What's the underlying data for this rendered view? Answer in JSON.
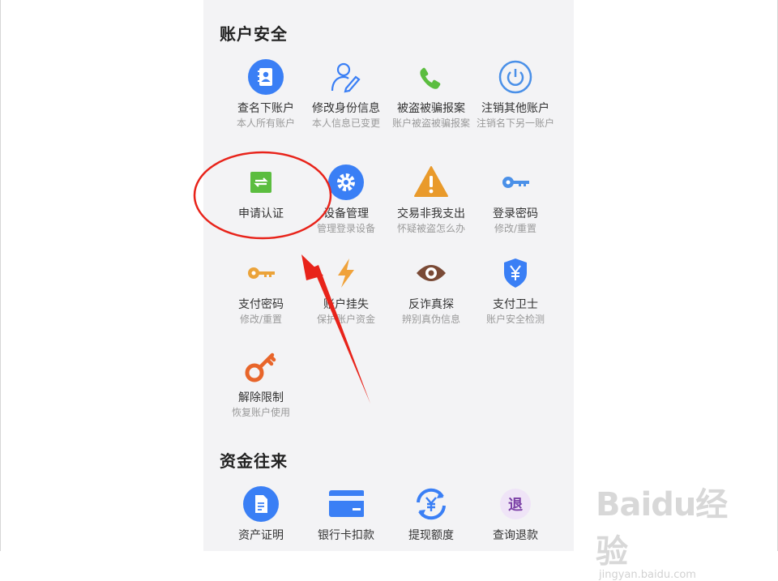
{
  "sections": [
    {
      "title": "账户安全",
      "items": [
        {
          "label": "查名下账户",
          "sub": "本人所有账户",
          "icon": "contacts-icon"
        },
        {
          "label": "修改身份信息",
          "sub": "本人信息已变更",
          "icon": "edit-user-icon"
        },
        {
          "label": "被盗被骗报案",
          "sub": "账户被盗被骗报案",
          "icon": "phone-icon"
        },
        {
          "label": "注销其他账户",
          "sub": "注销名下另一账户",
          "icon": "power-icon"
        },
        {
          "label": "申请认证",
          "sub": "",
          "icon": "swap-icon"
        },
        {
          "label": "设备管理",
          "sub": "管理登录设备",
          "icon": "gear-icon"
        },
        {
          "label": "交易非我支出",
          "sub": "怀疑被盗怎么办",
          "icon": "warning-icon"
        },
        {
          "label": "登录密码",
          "sub": "修改/重置",
          "icon": "key-blue-icon"
        },
        {
          "label": "支付密码",
          "sub": "修改/重置",
          "icon": "key-orange-icon"
        },
        {
          "label": "账户挂失",
          "sub": "保护账户资金",
          "icon": "lightning-icon"
        },
        {
          "label": "反诈真探",
          "sub": "辨别真伪信息",
          "icon": "eye-icon"
        },
        {
          "label": "支付卫士",
          "sub": "账户安全检测",
          "icon": "shield-yen-icon"
        },
        {
          "label": "解除限制",
          "sub": "恢复账户使用",
          "icon": "key-red-icon"
        }
      ]
    },
    {
      "title": "资金往来",
      "items": [
        {
          "label": "资产证明",
          "icon": "document-icon"
        },
        {
          "label": "银行卡扣款",
          "icon": "bank-card-icon"
        },
        {
          "label": "提现额度",
          "icon": "withdraw-icon"
        },
        {
          "label": "查询退款",
          "icon": "refund-icon"
        }
      ]
    }
  ],
  "refund_glyph": "退",
  "watermark": {
    "logo": "Baidu经验",
    "url": "jingyan.baidu.com"
  },
  "colors": {
    "accent": "#3a7ff5",
    "annotation": "#e8231a",
    "background": "#f3f3f5"
  }
}
